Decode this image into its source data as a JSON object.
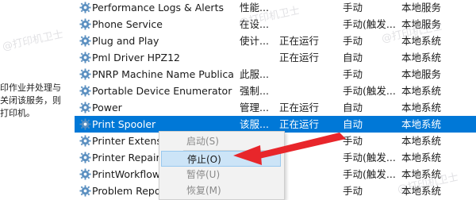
{
  "left_description": {
    "lines": [
      "印作业并处理与",
      "关闭该服务，则",
      "打印机。"
    ]
  },
  "services": [
    {
      "name": "Performance Logs & Alerts",
      "description": "性能...",
      "status": "",
      "startup": "手动",
      "logon": "本地服务"
    },
    {
      "name": "Phone Service",
      "description": "在设...",
      "status": "",
      "startup": "手动(触发...",
      "logon": "本地服务"
    },
    {
      "name": "Plug and Play",
      "description": "使计...",
      "status": "正在运行",
      "startup": "手动",
      "logon": "本地系统"
    },
    {
      "name": "Pml Driver HPZ12",
      "description": "",
      "status": "正在运行",
      "startup": "自动",
      "logon": "本地系统"
    },
    {
      "name": "PNRP Machine Name Publica...",
      "description": "此服...",
      "status": "",
      "startup": "手动",
      "logon": "本地服务"
    },
    {
      "name": "Portable Device Enumerator ...",
      "description": "强制...",
      "status": "",
      "startup": "手动(触发...",
      "logon": "本地系统"
    },
    {
      "name": "Power",
      "description": "管理...",
      "status": "正在运行",
      "startup": "自动",
      "logon": "本地系统"
    },
    {
      "name": "Print Spooler",
      "description": "该服...",
      "status": "正在运行",
      "startup": "自动",
      "logon": "本地系统",
      "selected": true
    },
    {
      "name": "Printer Extensio",
      "description": "",
      "status": "",
      "startup": "手动",
      "logon": "本地系统"
    },
    {
      "name": "Printer Repair",
      "description": "",
      "status": "",
      "startup": "手动(触发...",
      "logon": "本地系统"
    },
    {
      "name": "PrintWorkflow_",
      "description": "",
      "status": "",
      "startup": "手动(触发...",
      "logon": "本地系统"
    },
    {
      "name": "Problem Repo",
      "description": "",
      "status": "",
      "startup": "手动",
      "logon": "本地系统"
    }
  ],
  "context_menu": {
    "items": [
      {
        "label": "启动(S)",
        "enabled": false
      },
      {
        "label": "停止(O)",
        "enabled": true,
        "highlighted": true
      },
      {
        "label": "暂停(U)",
        "enabled": false
      },
      {
        "label": "恢复(M)",
        "enabled": false
      }
    ]
  },
  "watermark": "@打印机卫士",
  "colors": {
    "selection": "#0078d7",
    "menu_highlight": "#cce4f7",
    "arrow": "#e8262b",
    "icon_gear": "#5a8fc0"
  },
  "icons": {
    "service": "gear-icon",
    "arrow": "red-arrow-annotation"
  }
}
